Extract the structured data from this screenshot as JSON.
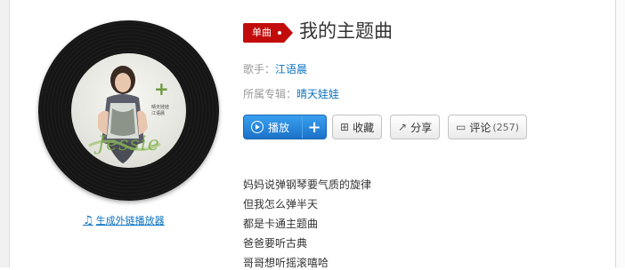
{
  "song": {
    "badge": "单曲",
    "title": "我的主题曲",
    "singer_label": "歌手：",
    "singer": "江语晨",
    "album_label": "所属专辑：",
    "album": "晴天娃娃"
  },
  "cover": {
    "signature": "Jessie",
    "album_name": "晴天娃娃",
    "artist_name": "江语晨"
  },
  "actions": {
    "play": "播放",
    "add": "+",
    "collect": "收藏",
    "share": "分享",
    "comment": "评论",
    "comment_count": "(257)"
  },
  "external_player": "生成外链播放器",
  "lyrics": [
    "妈妈说弹钢琴要气质的旋律",
    "但我怎么弹半天",
    "都是卡通主题曲",
    "爸爸要听古典",
    "哥哥想听摇滚嘻哈"
  ],
  "colors": {
    "badge": "#c20c0c",
    "link": "#0c73c2",
    "play_button": "#1b72c8"
  }
}
